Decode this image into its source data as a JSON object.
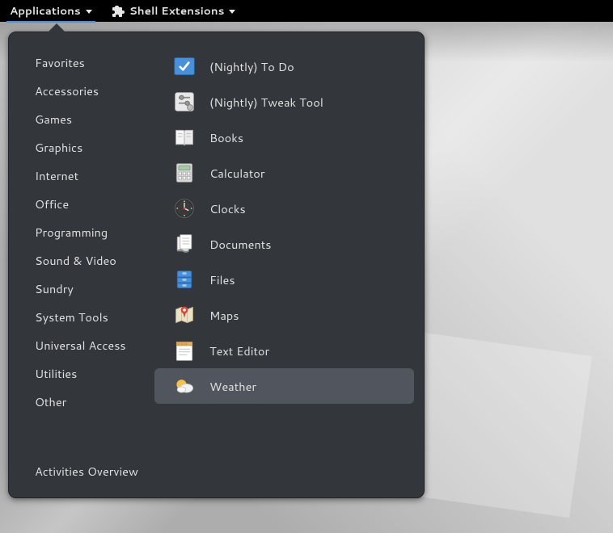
{
  "topbar": {
    "applications_label": "Applications",
    "shell_extensions_label": "Shell Extensions"
  },
  "menu": {
    "categories": [
      "Favorites",
      "Accessories",
      "Games",
      "Graphics",
      "Internet",
      "Office",
      "Programming",
      "Sound & Video",
      "Sundry",
      "System Tools",
      "Universal Access",
      "Utilities",
      "Other"
    ],
    "activities_label": "Activities Overview",
    "apps": [
      {
        "label": "(Nightly) To Do",
        "icon": "todo-icon",
        "highlight": false
      },
      {
        "label": "(Nightly) Tweak Tool",
        "icon": "tweaktool-icon",
        "highlight": false
      },
      {
        "label": "Books",
        "icon": "books-icon",
        "highlight": false
      },
      {
        "label": "Calculator",
        "icon": "calculator-icon",
        "highlight": false
      },
      {
        "label": "Clocks",
        "icon": "clocks-icon",
        "highlight": false
      },
      {
        "label": "Documents",
        "icon": "documents-icon",
        "highlight": false
      },
      {
        "label": "Files",
        "icon": "files-icon",
        "highlight": false
      },
      {
        "label": "Maps",
        "icon": "maps-icon",
        "highlight": false
      },
      {
        "label": "Text Editor",
        "icon": "texteditor-icon",
        "highlight": false
      },
      {
        "label": "Weather",
        "icon": "weather-icon",
        "highlight": true
      }
    ]
  }
}
